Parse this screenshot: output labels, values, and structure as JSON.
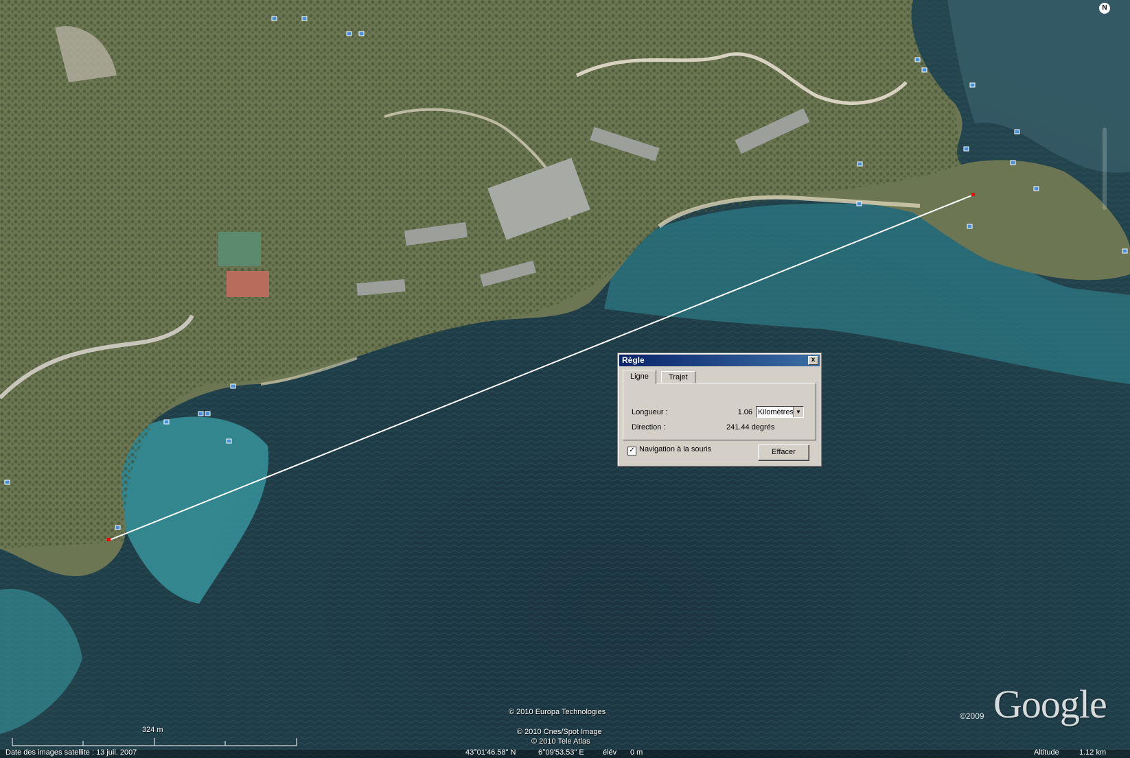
{
  "dialog": {
    "title": "Règle",
    "tabs": [
      {
        "label": "Ligne",
        "active": true
      },
      {
        "label": "Trajet",
        "active": false
      }
    ],
    "length_label": "Longueur :",
    "length_value": "1.06",
    "unit_selected": "Kilomètres",
    "direction_label": "Direction :",
    "direction_value": "241.44 degrés",
    "nav_checkbox_label": "Navigation à la souris",
    "nav_checked": true,
    "clear_button": "Effacer",
    "close_glyph": "x"
  },
  "map": {
    "copyright_europa": "© 2010 Europa Technologies",
    "copyright_cnes": "© 2010 Cnes/Spot Image",
    "copyright_tele": "© 2010 Tele Atlas",
    "google_year": "©2009",
    "google_logo": "Google",
    "scale_label": "324 m",
    "north_glyph": "N"
  },
  "status_bar": {
    "imagery_date": "Date des images satellite : 13 juil. 2007",
    "latitude": "43°01'46.58\" N",
    "longitude": "6°09'53.53\" E",
    "elevation_label": "élév",
    "elevation_value": "0 m",
    "altitude_label": "Altitude",
    "altitude_value": "1.12 km"
  },
  "colors": {
    "sea_deep": "#1f3c47",
    "sea_shallow": "#3fa1a8",
    "land": "#6f7c55",
    "measure_line": "#ffffff",
    "titlebar": "#0a246a"
  }
}
